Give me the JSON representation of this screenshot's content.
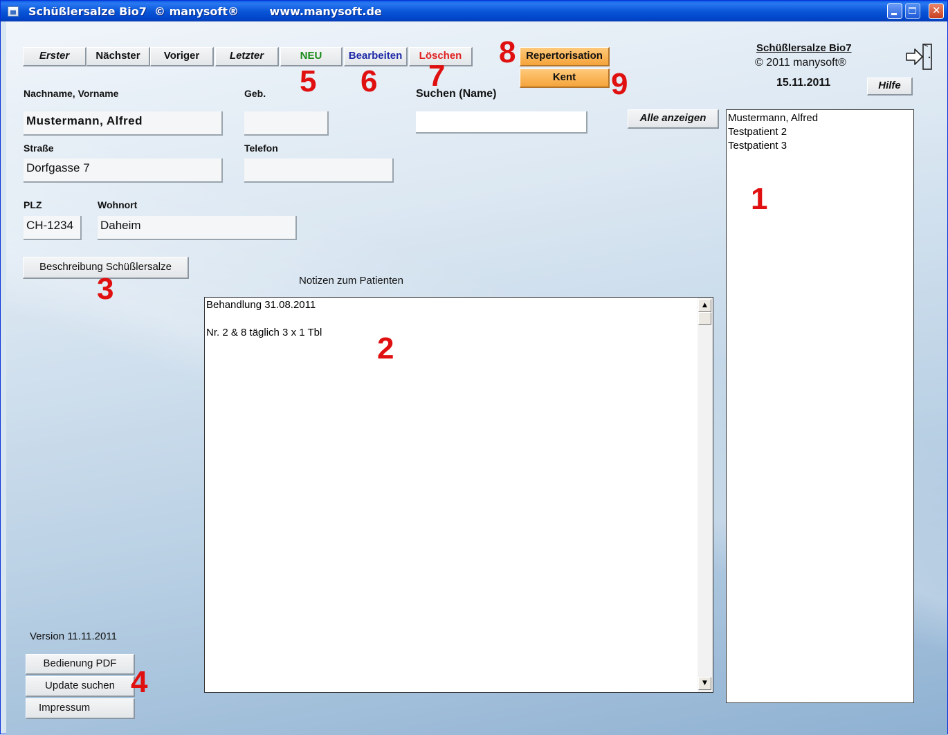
{
  "window": {
    "title": "Schüßlersalze Bio7  © manysoft®        www.manysoft.de"
  },
  "nav": {
    "first": "Erster",
    "next": "Nächster",
    "previous": "Voriger",
    "last": "Letzter"
  },
  "actions": {
    "new": "NEU",
    "edit": "Bearbeiten",
    "delete": "Löschen",
    "repertorisation": "Repertorisation",
    "kent": "Kent"
  },
  "colors": {
    "new": "#1a8a1a",
    "edit": "#1e2aa8",
    "delete": "#e02020",
    "marker": "#e01010",
    "orange": "#f5a43a"
  },
  "brand": {
    "name": "Schüßlersalze Bio7",
    "copyright": "©  2011 manysoft®",
    "date": "15.11.2011",
    "help": "Hilfe"
  },
  "labels": {
    "name": "Nachname, Vorname",
    "birth": "Geb.",
    "search": "Suchen (Name)",
    "street": "Straße",
    "phone": "Telefon",
    "zip": "PLZ",
    "city": "Wohnort",
    "notes": "Notizen zum Patienten"
  },
  "fields": {
    "name": "Mustermann, Alfred",
    "birth": "",
    "search": "",
    "street": "Dorfgasse 7",
    "phone": "",
    "zip": "CH-1234",
    "city": "Daheim"
  },
  "buttons": {
    "show_all": "Alle anzeigen",
    "description": "Beschreibung Schüßlersalze",
    "manual": "Bedienung PDF",
    "update": "Update suchen",
    "imprint": "Impressum"
  },
  "version": "Version 11.11.2011",
  "notes": [
    "Behandlung 31.08.2011",
    "",
    "Nr. 2 & 8 täglich 3 x 1 Tbl"
  ],
  "patients": [
    "Mustermann, Alfred",
    "Testpatient 2",
    "Testpatient 3"
  ],
  "markers": {
    "m1": "1",
    "m2": "2",
    "m3": "3",
    "m4": "4",
    "m5": "5",
    "m6": "6",
    "m7": "7",
    "m8": "8",
    "m9": "9"
  },
  "icons": {
    "exit": "exit-door-icon",
    "scroll_up": "arrow-up-icon",
    "scroll_down": "arrow-down-icon"
  }
}
